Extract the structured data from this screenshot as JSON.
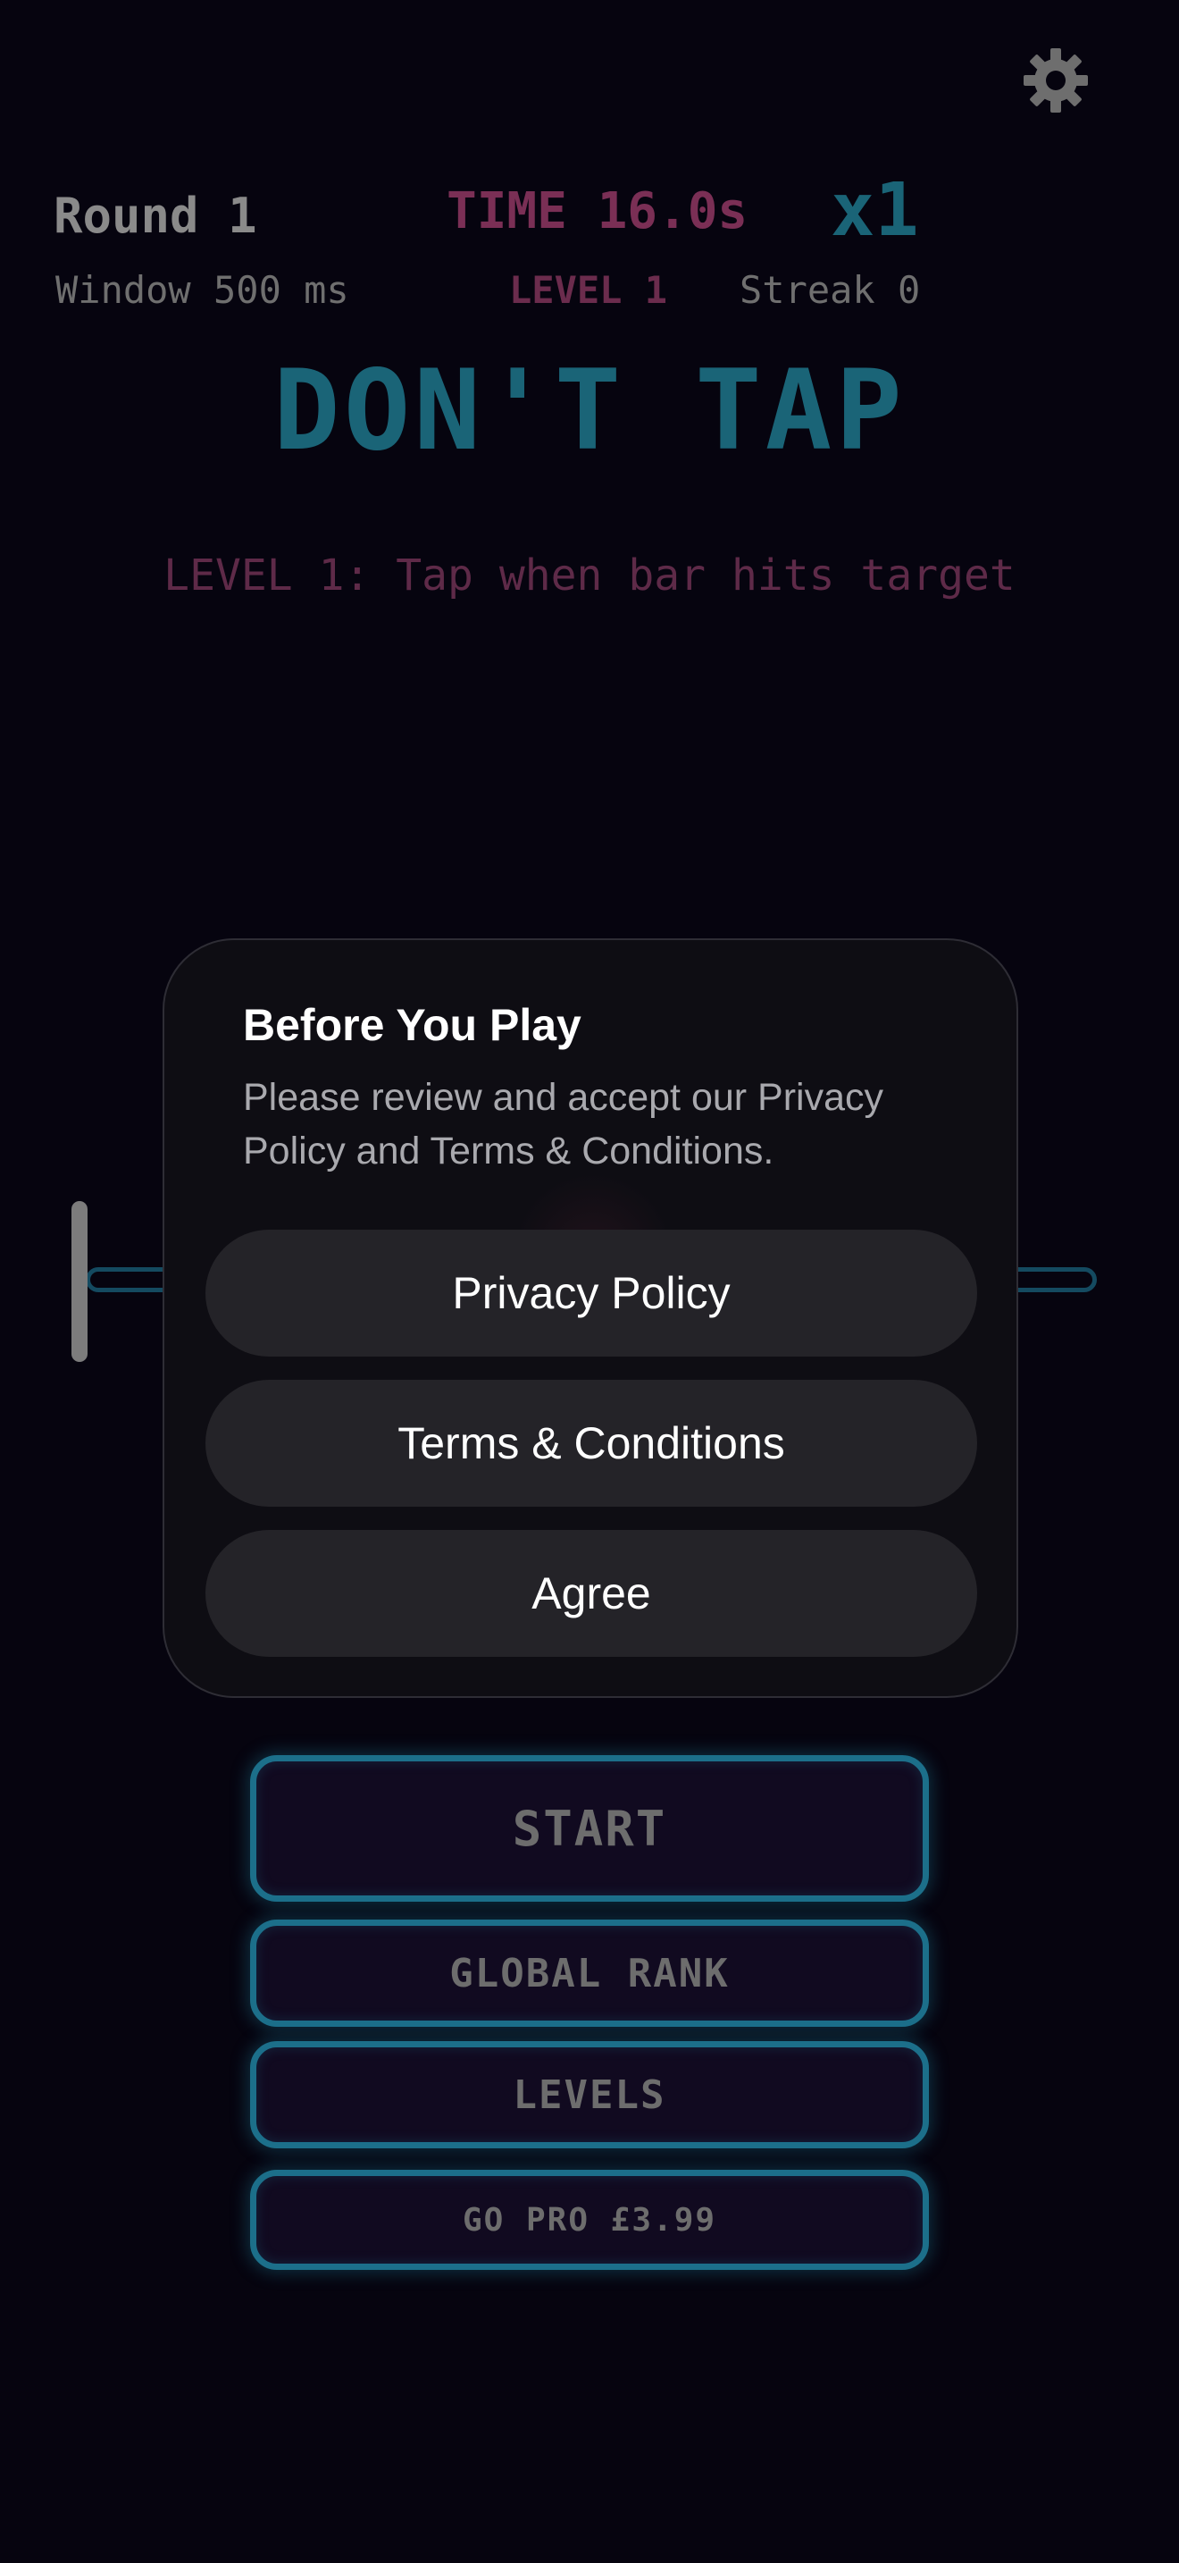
{
  "hud": {
    "settings_icon": "gear-icon",
    "round": "Round 1",
    "window": "Window 500 ms",
    "time": "TIME 16.0s",
    "multiplier": "x1",
    "level": "LEVEL 1",
    "streak": "Streak 0"
  },
  "game": {
    "title": "DON'T TAP",
    "instruction": "LEVEL 1: Tap when bar hits target"
  },
  "menu": {
    "start": "START",
    "global_rank": "GLOBAL RANK",
    "levels": "LEVELS",
    "go_pro": "GO PRO £3.99"
  },
  "modal": {
    "title": "Before You Play",
    "body": "Please review and accept our Privacy Policy and Terms & Conditions.",
    "privacy_button": "Privacy Policy",
    "terms_button": "Terms & Conditions",
    "agree_button": "Agree"
  },
  "colors": {
    "background": "#06040f",
    "accent_teal": "#1a6477",
    "accent_pink": "#7a2f55",
    "modal_bg": "#0e0d13",
    "modal_button_bg": "#242328"
  }
}
